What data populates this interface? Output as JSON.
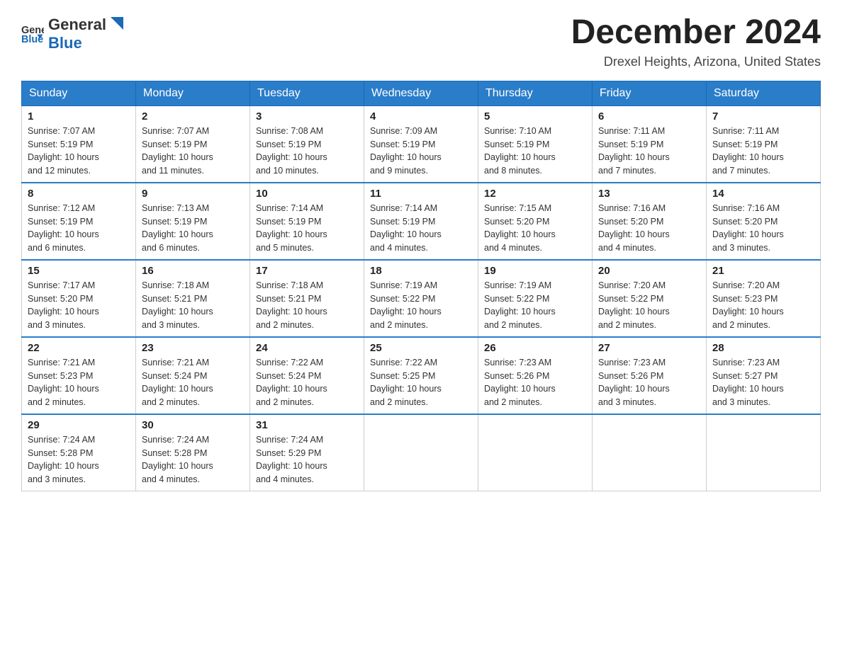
{
  "header": {
    "logo_general": "General",
    "logo_blue": "Blue",
    "month_title": "December 2024",
    "location": "Drexel Heights, Arizona, United States"
  },
  "weekdays": [
    "Sunday",
    "Monday",
    "Tuesday",
    "Wednesday",
    "Thursday",
    "Friday",
    "Saturday"
  ],
  "weeks": [
    [
      {
        "day": "1",
        "sunrise": "7:07 AM",
        "sunset": "5:19 PM",
        "daylight": "10 hours and 12 minutes."
      },
      {
        "day": "2",
        "sunrise": "7:07 AM",
        "sunset": "5:19 PM",
        "daylight": "10 hours and 11 minutes."
      },
      {
        "day": "3",
        "sunrise": "7:08 AM",
        "sunset": "5:19 PM",
        "daylight": "10 hours and 10 minutes."
      },
      {
        "day": "4",
        "sunrise": "7:09 AM",
        "sunset": "5:19 PM",
        "daylight": "10 hours and 9 minutes."
      },
      {
        "day": "5",
        "sunrise": "7:10 AM",
        "sunset": "5:19 PM",
        "daylight": "10 hours and 8 minutes."
      },
      {
        "day": "6",
        "sunrise": "7:11 AM",
        "sunset": "5:19 PM",
        "daylight": "10 hours and 7 minutes."
      },
      {
        "day": "7",
        "sunrise": "7:11 AM",
        "sunset": "5:19 PM",
        "daylight": "10 hours and 7 minutes."
      }
    ],
    [
      {
        "day": "8",
        "sunrise": "7:12 AM",
        "sunset": "5:19 PM",
        "daylight": "10 hours and 6 minutes."
      },
      {
        "day": "9",
        "sunrise": "7:13 AM",
        "sunset": "5:19 PM",
        "daylight": "10 hours and 6 minutes."
      },
      {
        "day": "10",
        "sunrise": "7:14 AM",
        "sunset": "5:19 PM",
        "daylight": "10 hours and 5 minutes."
      },
      {
        "day": "11",
        "sunrise": "7:14 AM",
        "sunset": "5:19 PM",
        "daylight": "10 hours and 4 minutes."
      },
      {
        "day": "12",
        "sunrise": "7:15 AM",
        "sunset": "5:20 PM",
        "daylight": "10 hours and 4 minutes."
      },
      {
        "day": "13",
        "sunrise": "7:16 AM",
        "sunset": "5:20 PM",
        "daylight": "10 hours and 4 minutes."
      },
      {
        "day": "14",
        "sunrise": "7:16 AM",
        "sunset": "5:20 PM",
        "daylight": "10 hours and 3 minutes."
      }
    ],
    [
      {
        "day": "15",
        "sunrise": "7:17 AM",
        "sunset": "5:20 PM",
        "daylight": "10 hours and 3 minutes."
      },
      {
        "day": "16",
        "sunrise": "7:18 AM",
        "sunset": "5:21 PM",
        "daylight": "10 hours and 3 minutes."
      },
      {
        "day": "17",
        "sunrise": "7:18 AM",
        "sunset": "5:21 PM",
        "daylight": "10 hours and 2 minutes."
      },
      {
        "day": "18",
        "sunrise": "7:19 AM",
        "sunset": "5:22 PM",
        "daylight": "10 hours and 2 minutes."
      },
      {
        "day": "19",
        "sunrise": "7:19 AM",
        "sunset": "5:22 PM",
        "daylight": "10 hours and 2 minutes."
      },
      {
        "day": "20",
        "sunrise": "7:20 AM",
        "sunset": "5:22 PM",
        "daylight": "10 hours and 2 minutes."
      },
      {
        "day": "21",
        "sunrise": "7:20 AM",
        "sunset": "5:23 PM",
        "daylight": "10 hours and 2 minutes."
      }
    ],
    [
      {
        "day": "22",
        "sunrise": "7:21 AM",
        "sunset": "5:23 PM",
        "daylight": "10 hours and 2 minutes."
      },
      {
        "day": "23",
        "sunrise": "7:21 AM",
        "sunset": "5:24 PM",
        "daylight": "10 hours and 2 minutes."
      },
      {
        "day": "24",
        "sunrise": "7:22 AM",
        "sunset": "5:24 PM",
        "daylight": "10 hours and 2 minutes."
      },
      {
        "day": "25",
        "sunrise": "7:22 AM",
        "sunset": "5:25 PM",
        "daylight": "10 hours and 2 minutes."
      },
      {
        "day": "26",
        "sunrise": "7:23 AM",
        "sunset": "5:26 PM",
        "daylight": "10 hours and 2 minutes."
      },
      {
        "day": "27",
        "sunrise": "7:23 AM",
        "sunset": "5:26 PM",
        "daylight": "10 hours and 3 minutes."
      },
      {
        "day": "28",
        "sunrise": "7:23 AM",
        "sunset": "5:27 PM",
        "daylight": "10 hours and 3 minutes."
      }
    ],
    [
      {
        "day": "29",
        "sunrise": "7:24 AM",
        "sunset": "5:28 PM",
        "daylight": "10 hours and 3 minutes."
      },
      {
        "day": "30",
        "sunrise": "7:24 AM",
        "sunset": "5:28 PM",
        "daylight": "10 hours and 4 minutes."
      },
      {
        "day": "31",
        "sunrise": "7:24 AM",
        "sunset": "5:29 PM",
        "daylight": "10 hours and 4 minutes."
      },
      null,
      null,
      null,
      null
    ]
  ],
  "labels": {
    "sunrise": "Sunrise:",
    "sunset": "Sunset:",
    "daylight": "Daylight:"
  }
}
